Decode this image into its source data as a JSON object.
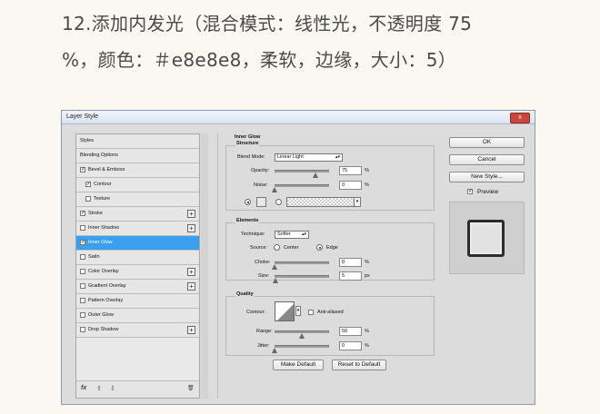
{
  "heading": {
    "line1": "12.添加内发光（混合模式：线性光，不透明度 75",
    "line2": "%，颜色：＃e8e8e8，柔软，边缘，大小：5）"
  },
  "dialog": {
    "title": "Layer Style",
    "close_label": "x",
    "left_panel": {
      "items": [
        {
          "label": "Styles"
        },
        {
          "label": "Blending Options"
        },
        {
          "label": "Bevel & Emboss",
          "checked": true
        },
        {
          "label": "Contour",
          "checked": true
        },
        {
          "label": "Texture",
          "checked": false
        },
        {
          "label": "Stroke",
          "checked": true
        },
        {
          "label": "Inner Shadow",
          "checked": false
        },
        {
          "label": "Inner Glow",
          "checked": true,
          "selected": true
        },
        {
          "label": "Satin",
          "checked": false
        },
        {
          "label": "Color Overlay",
          "checked": false
        },
        {
          "label": "Gradient Overlay",
          "checked": false
        },
        {
          "label": "Pattern Overlay",
          "checked": false
        },
        {
          "label": "Outer Glow",
          "checked": false
        },
        {
          "label": "Drop Shadow",
          "checked": false
        }
      ],
      "footer": {
        "fx": "fx",
        "up": "⇧",
        "down": "⇩",
        "trash": "🗑"
      }
    },
    "inner_glow": {
      "title": "Inner Glow",
      "structure": {
        "title": "Structure",
        "blend_mode_label": "Blend Mode:",
        "blend_mode_value": "Linear Light",
        "opacity_label": "Opacity:",
        "opacity_value": "75",
        "opacity_fraction": 0.75,
        "noise_label": "Noise:",
        "noise_value": "0",
        "noise_fraction": 0,
        "percent": "%",
        "color": "#e8e8e8"
      },
      "elements": {
        "title": "Elements",
        "technique_label": "Technique:",
        "technique_value": "Softer",
        "source_label": "Source:",
        "source_center": "Center",
        "source_edge": "Edge",
        "choke_label": "Choke:",
        "choke_value": "0",
        "choke_fraction": 0,
        "size_label": "Size:",
        "size_value": "5",
        "size_unit": "px",
        "percent": "%"
      },
      "quality": {
        "title": "Quality",
        "contour_label": "Contour:",
        "anti_aliased": "Anti-aliased",
        "range_label": "Range:",
        "range_value": "50",
        "range_fraction": 0.5,
        "jitter_label": "Jitter:",
        "jitter_value": "0",
        "jitter_fraction": 0,
        "percent": "%"
      },
      "make_default": "Make Default",
      "reset_default": "Reset to Default"
    },
    "buttons": {
      "ok": "OK",
      "cancel": "Cancel",
      "new_style": "New Style...",
      "preview": "Preview"
    }
  }
}
